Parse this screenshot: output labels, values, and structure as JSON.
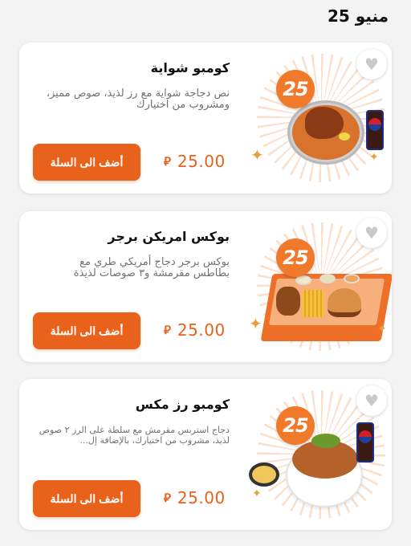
{
  "page": {
    "title": "منيو 25"
  },
  "colors": {
    "accent": "#e9621c",
    "badge": "#f07a2a",
    "background": "#f3f3f3",
    "card": "#ffffff"
  },
  "badge_text": "25",
  "items": [
    {
      "name": "كومبو شواية",
      "description": "نص دجاجة شواية مع رز لذيذ، صوص مميز، ومشروب من اختيارك",
      "price": "25.00",
      "currency_icon": "saudi-riyal-icon",
      "button_label": "أضف الى السلة",
      "image": "grilled-chicken-rice-combo-image"
    },
    {
      "name": "بوكس امريكن برجر",
      "description": "بوكس برجر دجاج أمريكي طري مع بطاطس مقرمشة و٣ صوصات لذيذة",
      "price": "25.00",
      "currency_icon": "saudi-riyal-icon",
      "button_label": "أضف الى السلة",
      "image": "burger-box-image"
    },
    {
      "name": "كومبو رز مكس",
      "description": "دجاج استربس مقرمش مع سلطة على الرز ٢ صوص لذيذ، مشروب من اختيارك، بالإضافة إل...",
      "price": "25.00",
      "currency_icon": "saudi-riyal-icon",
      "button_label": "أضف الى السلة",
      "image": "mixed-rice-bowl-combo-image"
    }
  ]
}
